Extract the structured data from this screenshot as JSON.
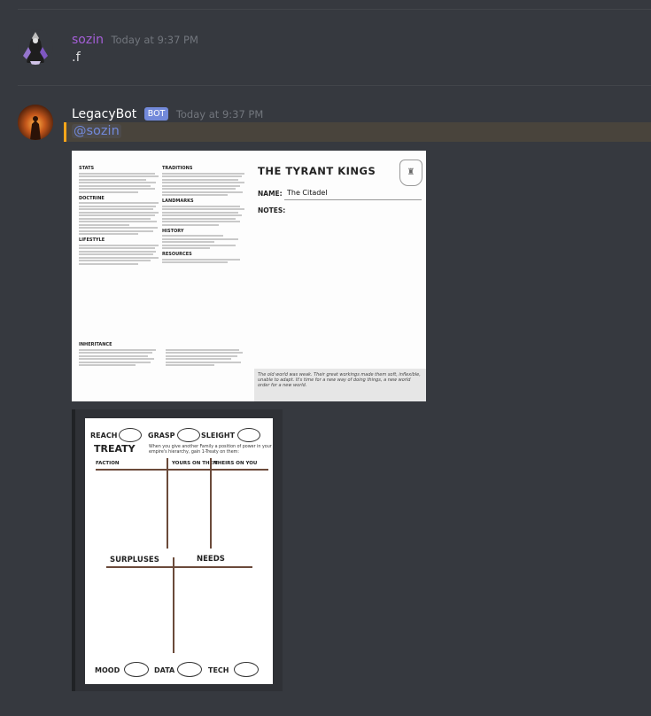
{
  "messages": [
    {
      "username": "sozin",
      "username_color": "#a55fd8",
      "timestamp": "Today at 9:37 PM",
      "text": ".f"
    },
    {
      "username": "LegacyBot",
      "username_color": "#ffffff",
      "bot_badge": "BOT",
      "timestamp": "Today at 9:37 PM",
      "mention": "@sozin"
    }
  ],
  "sheet1": {
    "title": "THE TYRANT KINGS",
    "name_label": "NAME:",
    "name_value": "The Citadel",
    "notes_label": "NOTES:",
    "left_headings": [
      "STATS",
      "DOCTRINE",
      "LIFESTYLE"
    ],
    "mid_headings": [
      "TRADITIONS",
      "LANDMARKS",
      "HISTORY",
      "RESOURCES"
    ],
    "bottom_heading": "INHERITANCE",
    "footer_text": "The old world was weak. Their great workings made them soft, inflexible, unable to adapt. It's time for a new way of doing things, a new world order for a new world."
  },
  "sheet2": {
    "reach": "REACH",
    "grasp": "GRASP",
    "sleight": "SLEIGHT",
    "treaty": "TREATY",
    "treaty_text": "When you give another Family a position of power in your empire's hierarchy, gain 1-Treaty on them:",
    "faction": "FACTION",
    "yours_on_them": "YOURS ON THEM",
    "theirs_on_you": "THEIRS ON YOU",
    "surpluses": "SURPLUSES",
    "needs": "NEEDS",
    "mood": "MOOD",
    "data": "DATA",
    "tech": "TECH"
  }
}
